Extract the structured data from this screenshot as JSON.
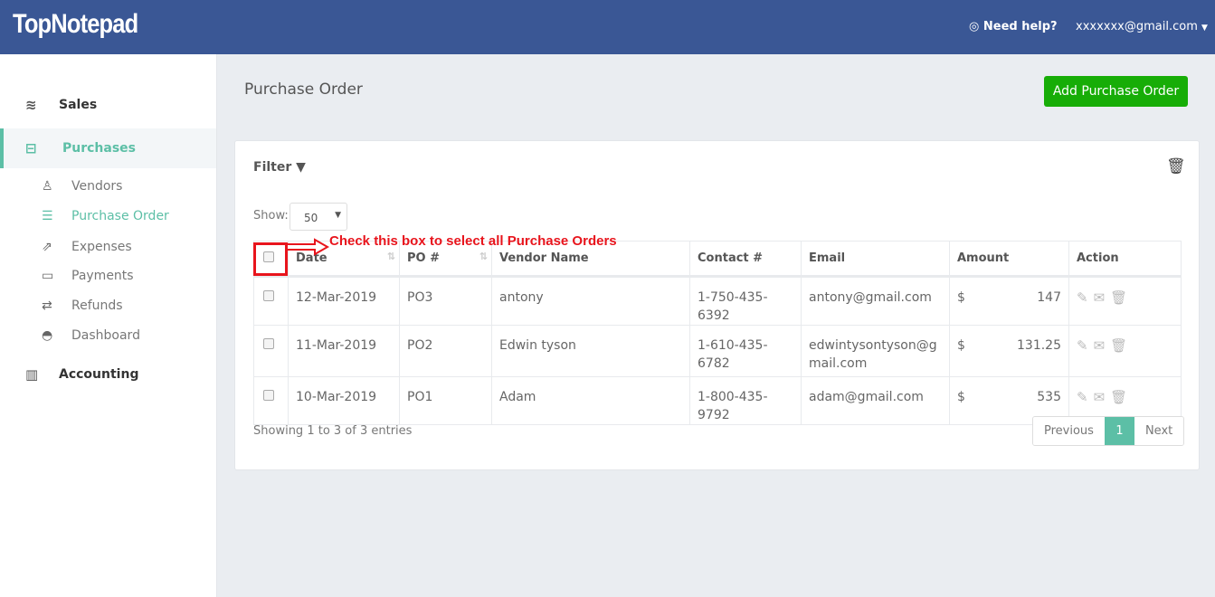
{
  "header": {
    "logo": "TopNotepad",
    "help": "Need help?",
    "user": "xxxxxxx@gmail.com"
  },
  "sidebar": {
    "items": [
      {
        "label": "Sales",
        "icon": "layers-icon"
      },
      {
        "label": "Purchases",
        "icon": "minus-square-icon",
        "active": true
      },
      {
        "label": "Accounting",
        "icon": "bar-chart-icon"
      }
    ],
    "sub_items": [
      {
        "label": "Vendors",
        "icon": "user-icon"
      },
      {
        "label": "Purchase Order",
        "icon": "list-icon",
        "active": true
      },
      {
        "label": "Expenses",
        "icon": "share-icon"
      },
      {
        "label": "Payments",
        "icon": "credit-card-icon"
      },
      {
        "label": "Refunds",
        "icon": "exchange-icon"
      },
      {
        "label": "Dashboard",
        "icon": "dashboard-icon"
      }
    ]
  },
  "page": {
    "title": "Purchase Order",
    "add_button": "Add Purchase Order",
    "filter": "Filter",
    "show_label": "Show:",
    "show_value": "50",
    "annotation": "Check this box to select all Purchase Orders",
    "columns": [
      "Date",
      "PO #",
      "Vendor Name",
      "Contact #",
      "Email",
      "Amount",
      "Action"
    ],
    "rows": [
      {
        "date": "12-Mar-2019",
        "po": "PO3",
        "vendor": "antony",
        "contact": "1-750-435-6392",
        "email": "antony@gmail.com",
        "currency": "$",
        "amount": "147"
      },
      {
        "date": "11-Mar-2019",
        "po": "PO2",
        "vendor": "Edwin tyson",
        "contact": "1-610-435-6782",
        "email": "edwintysontyson@gmail.com",
        "currency": "$",
        "amount": "131.25"
      },
      {
        "date": "10-Mar-2019",
        "po": "PO1",
        "vendor": "Adam",
        "contact": "1-800-435-9792",
        "email": "adam@gmail.com",
        "currency": "$",
        "amount": "535"
      }
    ],
    "info": "Showing 1 to 3 of 3 entries",
    "pager": {
      "prev": "Previous",
      "current": "1",
      "next": "Next"
    }
  },
  "colors": {
    "header": "#3a5795",
    "accent": "#5cbfa6",
    "add_button": "#17ad07",
    "annotation": "#e8141c"
  }
}
